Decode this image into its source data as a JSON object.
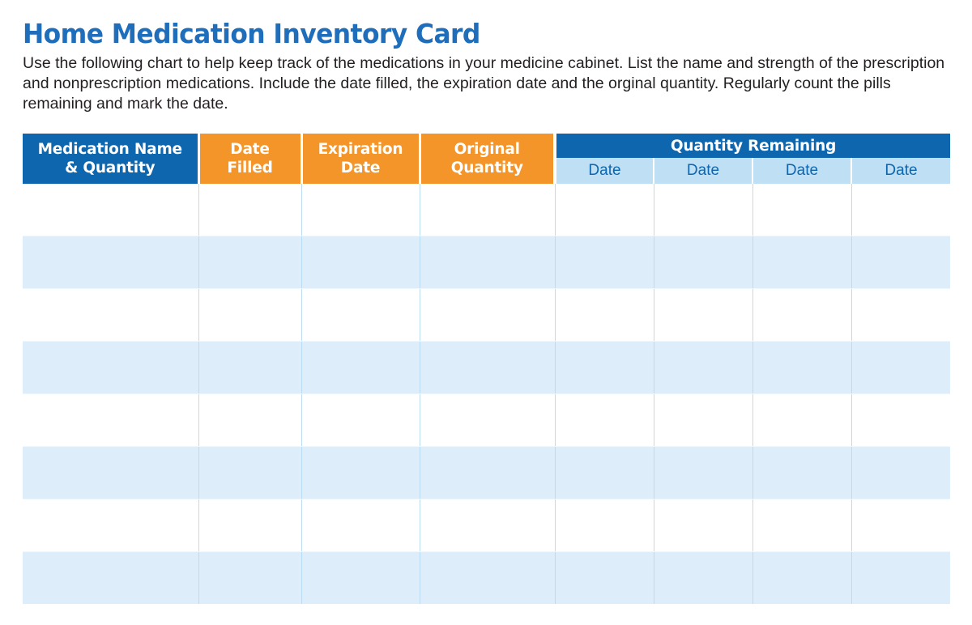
{
  "document": {
    "title": "Home Medication Inventory Card",
    "intro": "Use the following chart to help keep track of the medications in your medicine cabinet. List the name and strength of the prescription and nonprescription medications. Include the date filled, the expiration date and the orginal quantity. Regularly count the pills remaining and mark the date."
  },
  "colors": {
    "title_blue": "#1f6ebc",
    "header_blue": "#0d66ae",
    "header_orange": "#f4952a",
    "subheader_light_blue": "#bfdff5",
    "row_stripe": "#ddeefa",
    "grid_line": "#bcdcf3",
    "body_text": "#231f20"
  },
  "table": {
    "headers": {
      "medication_name": "Medication Name\n& Quantity",
      "medication_name_line1": "Medication Name",
      "medication_name_line2": "& Quantity",
      "date_filled_line1": "Date",
      "date_filled_line2": "Filled",
      "expiration_line1": "Expiration",
      "expiration_line2": "Date",
      "original_line1": "Original",
      "original_line2": "Quantity",
      "quantity_remaining_group": "Quantity Remaining",
      "date_subheaders": [
        "Date",
        "Date",
        "Date",
        "Date"
      ]
    },
    "columns": [
      "Medication Name & Quantity",
      "Date Filled",
      "Expiration Date",
      "Original Quantity",
      "Date",
      "Date",
      "Date",
      "Date"
    ],
    "row_count": 8,
    "rows": [
      [
        "",
        "",
        "",
        "",
        "",
        "",
        "",
        ""
      ],
      [
        "",
        "",
        "",
        "",
        "",
        "",
        "",
        ""
      ],
      [
        "",
        "",
        "",
        "",
        "",
        "",
        "",
        ""
      ],
      [
        "",
        "",
        "",
        "",
        "",
        "",
        "",
        ""
      ],
      [
        "",
        "",
        "",
        "",
        "",
        "",
        "",
        ""
      ],
      [
        "",
        "",
        "",
        "",
        "",
        "",
        "",
        ""
      ],
      [
        "",
        "",
        "",
        "",
        "",
        "",
        "",
        ""
      ],
      [
        "",
        "",
        "",
        "",
        "",
        "",
        "",
        ""
      ]
    ]
  }
}
